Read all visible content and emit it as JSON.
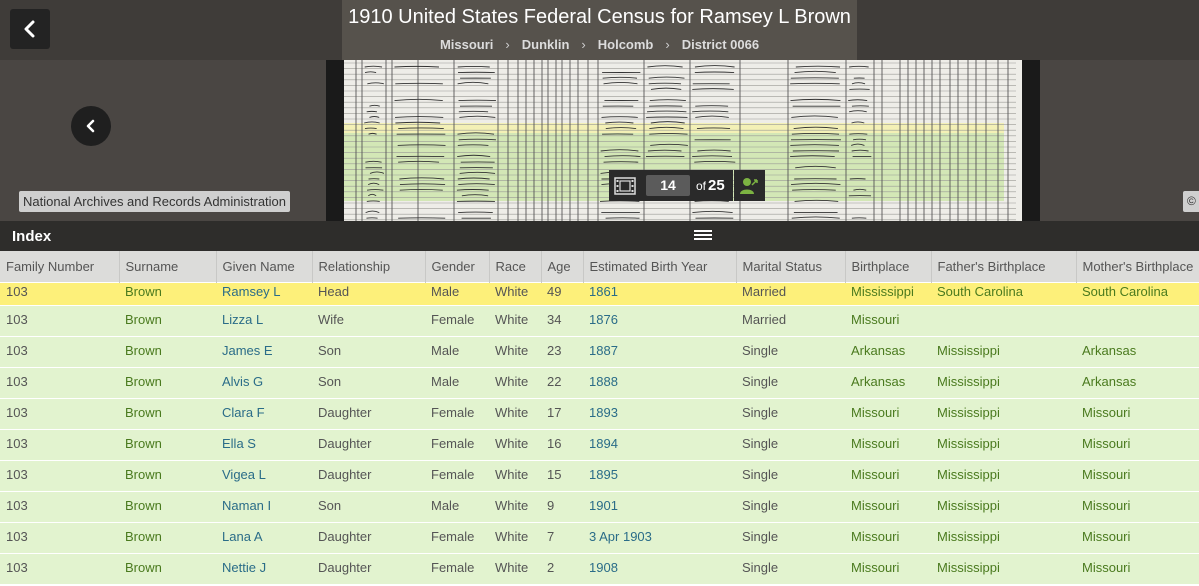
{
  "header": {
    "title": "1910 United States Federal Census for Ramsey L Brown",
    "breadcrumbs": [
      "Missouri",
      "Dunklin",
      "Holcomb",
      "District 0066"
    ],
    "breadcrumb_separator": "›"
  },
  "viewer": {
    "credit": "National Archives and Records Administration",
    "credit_right": "©",
    "page_current": "14",
    "page_of": "of",
    "page_total": "25"
  },
  "index": {
    "title": "Index"
  },
  "table": {
    "columns": [
      "Family Number",
      "Surname",
      "Given Name",
      "Relationship",
      "Gender",
      "Race",
      "Age",
      "Estimated Birth Year",
      "Marital Status",
      "Birthplace",
      "Father's Birthplace",
      "Mother's Birthplace"
    ],
    "rows": [
      [
        "103",
        "Brown",
        "Ramsey L",
        "Head",
        "Male",
        "White",
        "49",
        "1861",
        "Married",
        "Mississippi",
        "South Carolina",
        "South Carolina"
      ],
      [
        "103",
        "Brown",
        "Lizza L",
        "Wife",
        "Female",
        "White",
        "34",
        "1876",
        "Married",
        "Missouri",
        "",
        ""
      ],
      [
        "103",
        "Brown",
        "James E",
        "Son",
        "Male",
        "White",
        "23",
        "1887",
        "Single",
        "Arkansas",
        "Mississippi",
        "Arkansas"
      ],
      [
        "103",
        "Brown",
        "Alvis G",
        "Son",
        "Male",
        "White",
        "22",
        "1888",
        "Single",
        "Arkansas",
        "Mississippi",
        "Arkansas"
      ],
      [
        "103",
        "Brown",
        "Clara F",
        "Daughter",
        "Female",
        "White",
        "17",
        "1893",
        "Single",
        "Missouri",
        "Mississippi",
        "Missouri"
      ],
      [
        "103",
        "Brown",
        "Ella S",
        "Daughter",
        "Female",
        "White",
        "16",
        "1894",
        "Single",
        "Missouri",
        "Mississippi",
        "Missouri"
      ],
      [
        "103",
        "Brown",
        "Vigea L",
        "Daughter",
        "Female",
        "White",
        "15",
        "1895",
        "Single",
        "Missouri",
        "Mississippi",
        "Missouri"
      ],
      [
        "103",
        "Brown",
        "Naman I",
        "Son",
        "Male",
        "White",
        "9",
        "1901",
        "Single",
        "Missouri",
        "Mississippi",
        "Missouri"
      ],
      [
        "103",
        "Brown",
        "Lana A",
        "Daughter",
        "Female",
        "White",
        "7",
        "3 Apr 1903",
        "Single",
        "Missouri",
        "Mississippi",
        "Missouri"
      ],
      [
        "103",
        "Brown",
        "Nettie J",
        "Daughter",
        "Female",
        "White",
        "2",
        "1908",
        "Single",
        "Missouri",
        "Mississippi",
        "Missouri"
      ]
    ],
    "selected_row": 0
  },
  "colors": {
    "selected_row": "#fdf07a",
    "household_row": "#e2f3cf",
    "surname_text": "#4a7a1e",
    "given_name_text": "#2a6c88"
  },
  "icons": {
    "back": "chevron-left-icon",
    "previous": "chevron-left-icon",
    "film": "filmstrip-icon",
    "person": "person-icon",
    "menu": "hamburger-menu-icon"
  }
}
